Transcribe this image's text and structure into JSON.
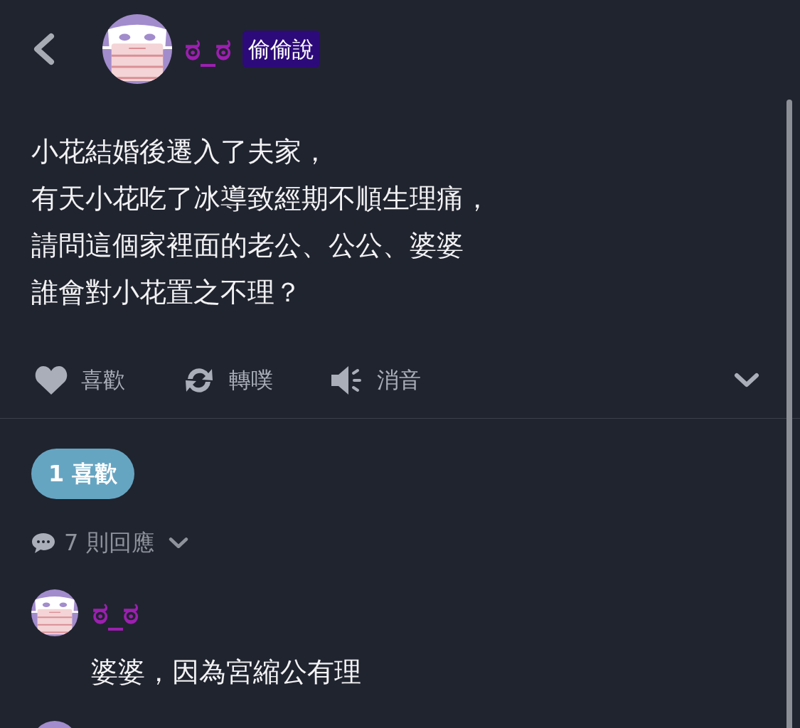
{
  "header": {
    "author": "ಠ_ಠ",
    "badge": "偷偷說"
  },
  "post": {
    "lines": [
      "小花結婚後遷入了夫家，",
      "有天小花吃了冰導致經期不順生理痛，",
      "請問這個家裡面的老公、公公、婆婆",
      "誰會對小花置之不理？"
    ]
  },
  "actions": [
    {
      "kind": "like",
      "label": "喜歡"
    },
    {
      "kind": "replurk",
      "label": "轉噗"
    },
    {
      "kind": "mute",
      "label": "消音"
    }
  ],
  "likes": "1 喜歡",
  "response_count": "7 則回應",
  "comments": [
    {
      "author": "ಠ_ಠ",
      "text": "婆婆，因為宮縮公有理"
    },
    {
      "cut_off": true
    }
  ]
}
